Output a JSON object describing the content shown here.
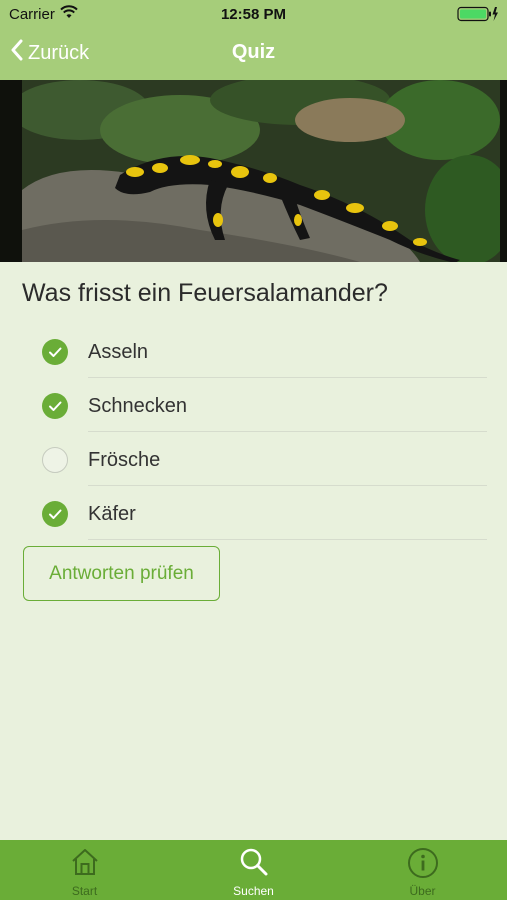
{
  "status_bar": {
    "carrier": "Carrier",
    "time": "12:58 PM"
  },
  "nav": {
    "back_label": "Zurück",
    "title": "Quiz"
  },
  "quiz": {
    "question": "Was frisst ein Feuersalamander?",
    "options": [
      {
        "label": "Asseln",
        "checked": true
      },
      {
        "label": "Schnecken",
        "checked": true
      },
      {
        "label": "Frösche",
        "checked": false
      },
      {
        "label": "Käfer",
        "checked": true
      }
    ],
    "submit_label": "Antworten prüfen"
  },
  "tabbar": {
    "tabs": [
      {
        "label": "Start",
        "icon": "home-icon",
        "active": false
      },
      {
        "label": "Suchen",
        "icon": "search-icon",
        "active": true
      },
      {
        "label": "Über",
        "icon": "info-icon",
        "active": false
      }
    ]
  },
  "colors": {
    "nav_bar": "#a6cd7a",
    "accent": "#6aad37",
    "background": "#e9f1dd"
  }
}
